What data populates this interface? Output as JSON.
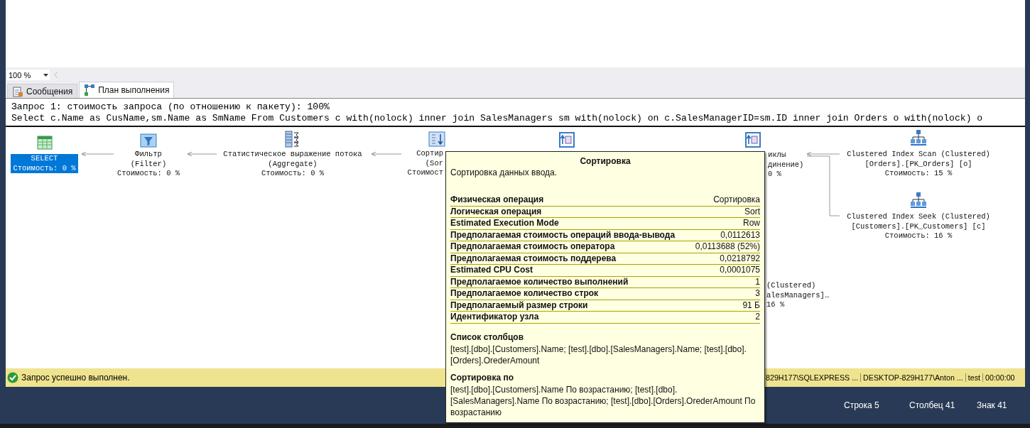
{
  "zoom": {
    "value": "100 %"
  },
  "tabs": [
    {
      "label": "Сообщения",
      "selected": false,
      "kind": "messages"
    },
    {
      "label": "План выполнения",
      "selected": true,
      "kind": "plan"
    }
  ],
  "plan": {
    "header": [
      "Запрос 1: стоимость запроса (по отношению к пакету): 100%",
      "Select c.Name as CusName,sm.Name as SmName From Customers c with(nolock) inner join SalesManagers sm with(nolock) on c.SalesManagerID=sm.ID inner join Orders o with(nolock) o"
    ],
    "nodes": [
      {
        "kind": "select",
        "selected": true,
        "lines": [
          "SELECT",
          "Стоимость: 0 %"
        ]
      },
      {
        "kind": "filter",
        "selected": false,
        "lines": [
          "Фильтр",
          "(Filter)",
          "Стоимость: 0 %"
        ]
      },
      {
        "kind": "aggregate",
        "selected": false,
        "lines": [
          "Статистическое выражение потока",
          "(Aggregate)",
          "Стоимость: 0 %"
        ]
      },
      {
        "kind": "sort",
        "selected": false,
        "lines": [
          "Сортир",
          "(Sor",
          "Стоимост"
        ]
      },
      {
        "kind": "compute",
        "selected": false
      },
      {
        "kind": "loops",
        "selected": false,
        "lines": [
          "иклы",
          "динение)",
          "0 %"
        ]
      },
      {
        "kind": "scan",
        "selected": false,
        "lines": [
          "Clustered Index Scan (Clustered)",
          "[Orders].[PK_Orders] [o]",
          "Стоимость: 15 %"
        ]
      },
      {
        "kind": "seek",
        "selected": false,
        "lines": [
          "Clustered Index Seek (Clustered)",
          "[Customers].[PK_Customers] [c]",
          "Стоимость: 16 %"
        ]
      },
      {
        "kind": "hidden",
        "selected": false,
        "lines": [
          "(Clustered)",
          "alesManagers]…",
          "16 %"
        ]
      }
    ]
  },
  "tooltip": {
    "title": "Сортировка",
    "description": "Сортировка данных ввода.",
    "rows": [
      {
        "label": "Физическая операция",
        "value": "Сортировка"
      },
      {
        "label": "Логическая операция",
        "value": "Sort"
      },
      {
        "label": "Estimated Execution Mode",
        "value": "Row"
      },
      {
        "label": "Предполагаемая стоимость операций ввода-вывода",
        "value": "0,0112613"
      },
      {
        "label": "Предполагаемая стоимость оператора",
        "value": "0,0113688 (52%)"
      },
      {
        "label": "Предполагаемая стоимость поддерева",
        "value": "0,0218792"
      },
      {
        "label": "Estimated CPU Cost",
        "value": "0,0001075"
      },
      {
        "label": "Предполагаемое количество выполнений",
        "value": "1"
      },
      {
        "label": "Предполагаемое количество строк",
        "value": "3"
      },
      {
        "label": "Предполагаемый размер строки",
        "value": "91 Б"
      },
      {
        "label": "Идентификатор узла",
        "value": "2"
      }
    ],
    "sections": [
      {
        "heading": "Список столбцов",
        "text": "[test].[dbo].[Customers].Name; [test].[dbo].[SalesManagers].Name; [test].[dbo].[Orders].OrederAmount"
      },
      {
        "heading": "Сортировка по",
        "text": "[test].[dbo].[Customers].Name По возрастанию; [test].[dbo].[SalesManagers].Name По возрастанию; [test].[dbo].[Orders].OrederAmount По возрастанию"
      }
    ]
  },
  "status": {
    "message": "Запрос успешно выполнен.",
    "segments": [
      "829H177\\SQLEXPRESS ...",
      "DESKTOP-829H177\\Anton ...",
      "test",
      "00:00:00"
    ]
  },
  "caret": [
    "Строка 5",
    "Столбец 41",
    "Знак 41"
  ]
}
